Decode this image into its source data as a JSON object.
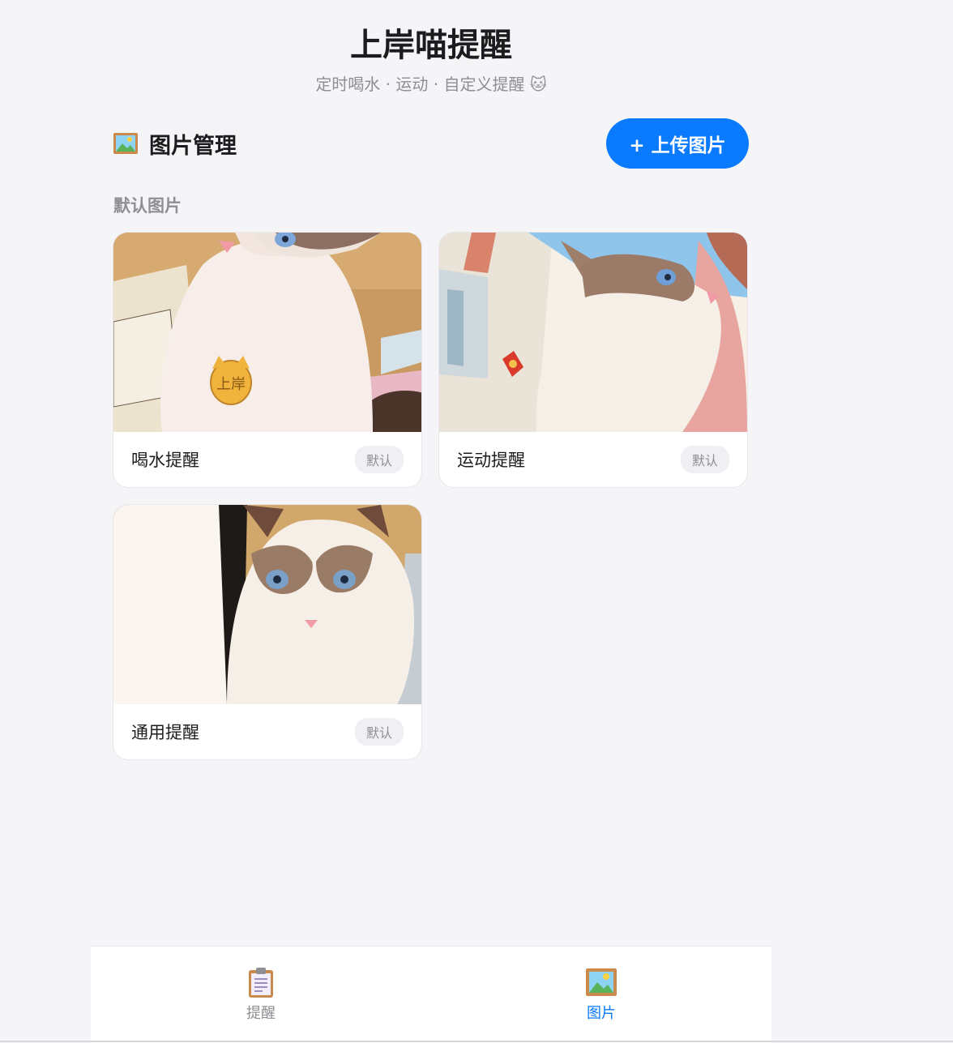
{
  "header": {
    "title": "上岸喵提醒",
    "subtitle": "定时喝水 · 运动 · 自定义提醒 🐱"
  },
  "section": {
    "icon": "framed-picture-icon",
    "title": "图片管理",
    "upload_label": "+ 上传图片"
  },
  "group": {
    "label": "默认图片"
  },
  "images": [
    {
      "name": "喝水提醒",
      "badge": "默认",
      "tag_text": "上岸"
    },
    {
      "name": "运动提醒",
      "badge": "默认"
    },
    {
      "name": "通用提醒",
      "badge": "默认"
    }
  ],
  "tabs": [
    {
      "label": "提醒",
      "icon": "clipboard-icon",
      "active": false
    },
    {
      "label": "图片",
      "icon": "framed-picture-icon",
      "active": true
    }
  ],
  "colors": {
    "accent": "#0a7aff",
    "background": "#f5f5f7",
    "muted": "#8e8e93"
  }
}
